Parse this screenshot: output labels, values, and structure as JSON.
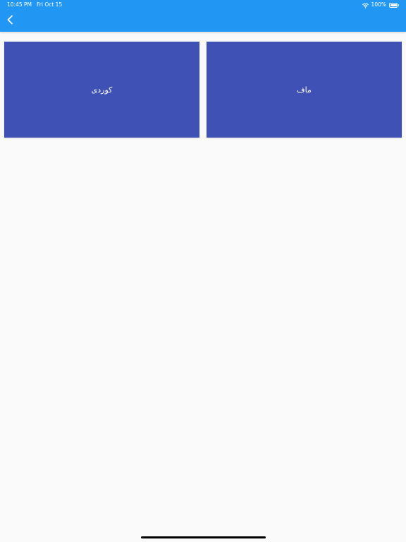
{
  "status_bar": {
    "time": "10:45 PM",
    "date": "Fri Oct 15",
    "battery_percent": "100%",
    "battery_level": 1.0,
    "wifi_icon": "wifi-icon",
    "battery_icon": "battery-icon"
  },
  "toolbar": {
    "back_icon": "chevron-left-icon"
  },
  "cards": [
    {
      "label": "کوردی"
    },
    {
      "label": "ماف"
    }
  ],
  "colors": {
    "toolbar": "#2196f3",
    "card": "#3f51b5",
    "background": "#fafafa",
    "text_on_primary": "#ffffff"
  }
}
